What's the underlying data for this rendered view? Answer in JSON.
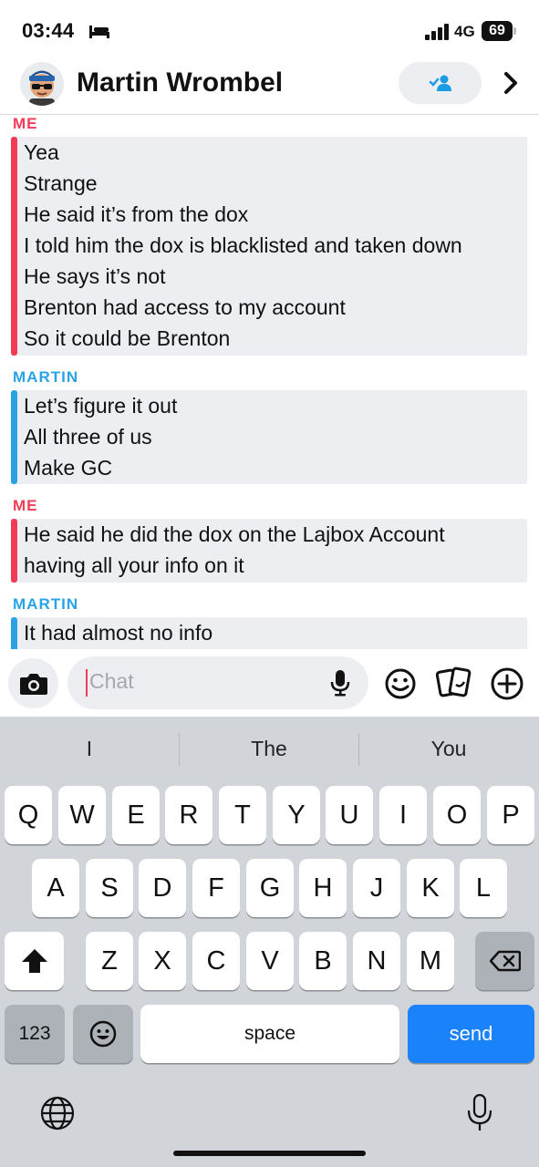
{
  "status_bar": {
    "time": "03:44",
    "network": "4G",
    "battery": "69"
  },
  "header": {
    "contact_name": "Martin Wrombel"
  },
  "messages": [
    {
      "sender": "ME",
      "lines": [
        "Yea",
        "Strange",
        "He said it’s from the dox",
        "I told him the dox is blacklisted and taken down",
        "He says it’s not",
        "Brenton had access to my account",
        "So it could be Brenton"
      ]
    },
    {
      "sender": "MARTIN",
      "lines": [
        "Let’s figure it out",
        "All three of us",
        "Make GC"
      ]
    },
    {
      "sender": "ME",
      "lines": [
        "He said he did the dox on the Lajbox Account",
        "having all your info on it"
      ]
    },
    {
      "sender": "MARTIN",
      "lines": [
        "It had almost no info"
      ]
    }
  ],
  "input": {
    "placeholder": "Chat"
  },
  "keyboard": {
    "suggestions": [
      "I",
      "The",
      "You"
    ],
    "row1": [
      "Q",
      "W",
      "E",
      "R",
      "T",
      "Y",
      "U",
      "I",
      "O",
      "P"
    ],
    "row2": [
      "A",
      "S",
      "D",
      "F",
      "G",
      "H",
      "J",
      "K",
      "L"
    ],
    "row3": [
      "Z",
      "X",
      "C",
      "V",
      "B",
      "N",
      "M"
    ],
    "numbers_label": "123",
    "space_label": "space",
    "send_label": "send"
  },
  "colors": {
    "me": "#f23c57",
    "martin": "#2aa3e6",
    "send": "#1a82fb"
  }
}
